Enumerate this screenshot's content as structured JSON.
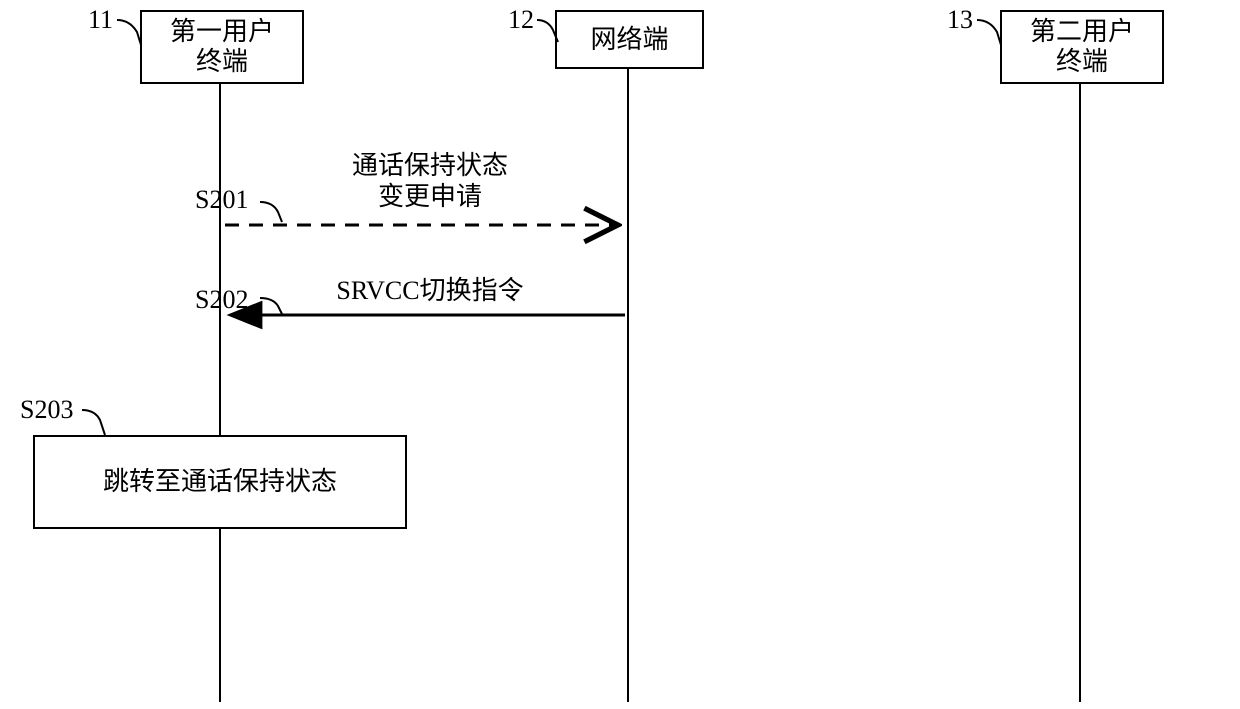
{
  "participants": {
    "p1": {
      "ref": "11",
      "label": "第一用户\n终端"
    },
    "p2": {
      "ref": "12",
      "label": "网络端"
    },
    "p3": {
      "ref": "13",
      "label": "第二用户\n终端"
    }
  },
  "messages": {
    "m1": {
      "seq": "S201",
      "text": "通话保持状态\n变更申请"
    },
    "m2": {
      "seq": "S202",
      "text": "SRVCC切换指令"
    }
  },
  "steps": {
    "s3": {
      "seq": "S203",
      "text": "跳转至通话保持状态"
    }
  }
}
